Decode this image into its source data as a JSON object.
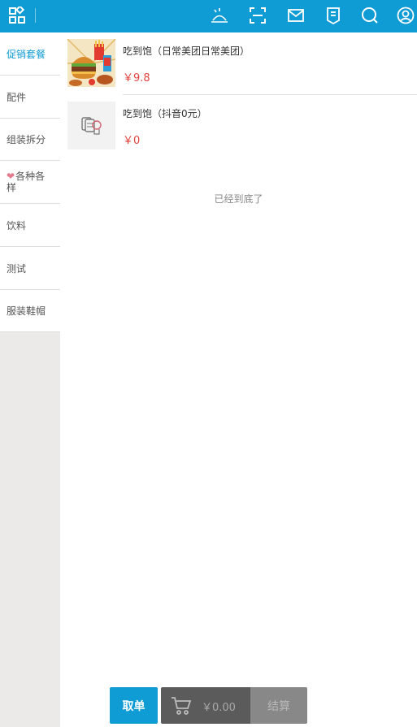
{
  "topbar": {
    "color": "#0f9bd3",
    "icons": [
      "grid-menu-icon",
      "food-cover-icon",
      "scan-icon",
      "mail-icon",
      "receipt-icon",
      "search-icon",
      "user-icon"
    ]
  },
  "sidebar": {
    "items": [
      {
        "label": "促销套餐",
        "active": true
      },
      {
        "label": "配件",
        "active": false
      },
      {
        "label": "组装拆分",
        "active": false
      },
      {
        "label": "各种各样",
        "active": false,
        "icon": "heart-icon"
      },
      {
        "label": "饮料",
        "active": false
      },
      {
        "label": "测试",
        "active": false
      },
      {
        "label": "服装鞋帽",
        "active": false
      }
    ]
  },
  "products": [
    {
      "name": "吃到饱（日常美团日常美团）",
      "price": "￥9.8",
      "image": "burger-combo-image"
    },
    {
      "name": "吃到饱（抖音0元）",
      "price": "￥0",
      "image": "placeholder-image"
    }
  ],
  "list_end_text": "已经到底了",
  "footer": {
    "order_label": "取单",
    "cart_total": "￥0.00",
    "checkout_label": "结算"
  }
}
